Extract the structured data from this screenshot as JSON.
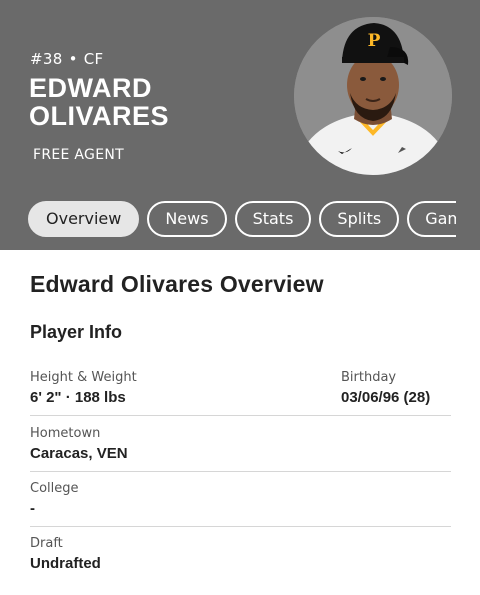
{
  "player": {
    "number": "#38",
    "position": "CF",
    "first_name": "EDWARD",
    "last_name": "OLIVARES",
    "status": "FREE AGENT"
  },
  "tabs": [
    "Overview",
    "News",
    "Stats",
    "Splits",
    "Game"
  ],
  "active_tab": "Overview",
  "overview": {
    "title": "Edward Olivares Overview",
    "section_title": "Player Info",
    "height_weight_label": "Height & Weight",
    "height_weight_value": "6' 2\" · 188 lbs",
    "birthday_label": "Birthday",
    "birthday_value": "03/06/96 (28)",
    "hometown_label": "Hometown",
    "hometown_value": "Caracas, VEN",
    "college_label": "College",
    "college_value": "-",
    "draft_label": "Draft",
    "draft_value": "Undrafted"
  },
  "colors": {
    "header_bg": "#6a6a6a",
    "cap_black": "#111111",
    "logo_gold": "#fdb827"
  },
  "icons": {
    "logo": "pirates-p-logo-icon",
    "swoosh": "nike-swoosh-icon"
  }
}
